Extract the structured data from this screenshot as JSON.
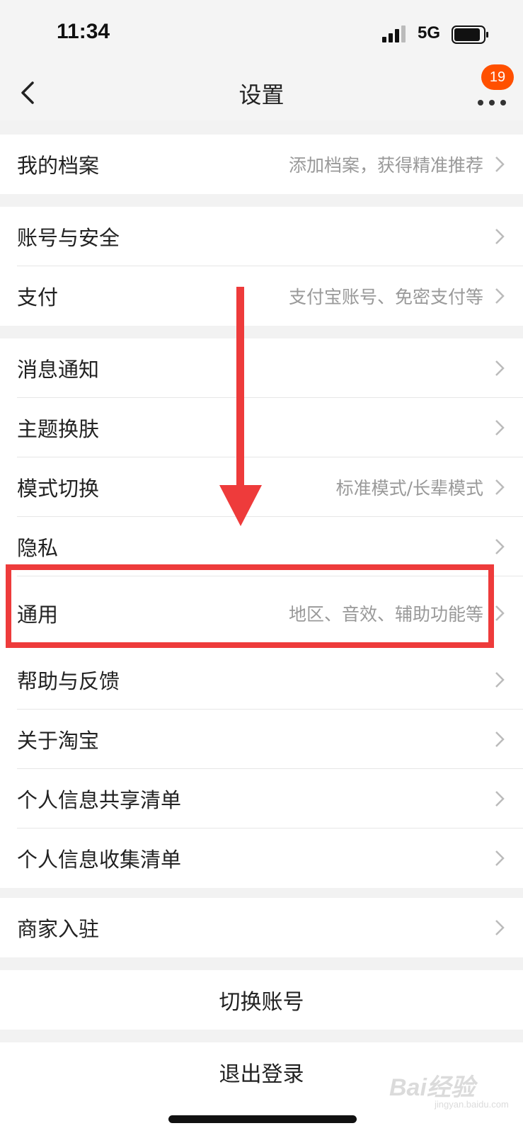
{
  "status_bar": {
    "time": "11:34",
    "network": "5G"
  },
  "nav": {
    "title": "设置",
    "badge_count": "19"
  },
  "groups": [
    {
      "items": [
        {
          "label": "我的档案",
          "sub": "添加档案，获得精准推荐"
        }
      ]
    },
    {
      "items": [
        {
          "label": "账号与安全",
          "sub": ""
        },
        {
          "label": "支付",
          "sub": "支付宝账号、免密支付等"
        }
      ]
    },
    {
      "items": [
        {
          "label": "消息通知",
          "sub": ""
        },
        {
          "label": "主题换肤",
          "sub": ""
        },
        {
          "label": "模式切换",
          "sub": "标准模式/长辈模式"
        },
        {
          "label": "隐私",
          "sub": ""
        },
        {
          "label": "通用",
          "sub": "地区、音效、辅助功能等"
        },
        {
          "label": "帮助与反馈",
          "sub": ""
        },
        {
          "label": "关于淘宝",
          "sub": ""
        },
        {
          "label": "个人信息共享清单",
          "sub": ""
        },
        {
          "label": "个人信息收集清单",
          "sub": ""
        }
      ]
    },
    {
      "items": [
        {
          "label": "商家入驻",
          "sub": ""
        }
      ]
    }
  ],
  "actions": {
    "switch_account": "切换账号",
    "logout": "退出登录"
  },
  "watermark": {
    "text": "Bai经验",
    "sub": "jingyan.baidu.com"
  },
  "colors": {
    "accent": "#ff5000",
    "annotation": "#ee3b3b"
  },
  "annotations": {
    "highlighted_item": "通用",
    "arrow_direction": "down"
  }
}
